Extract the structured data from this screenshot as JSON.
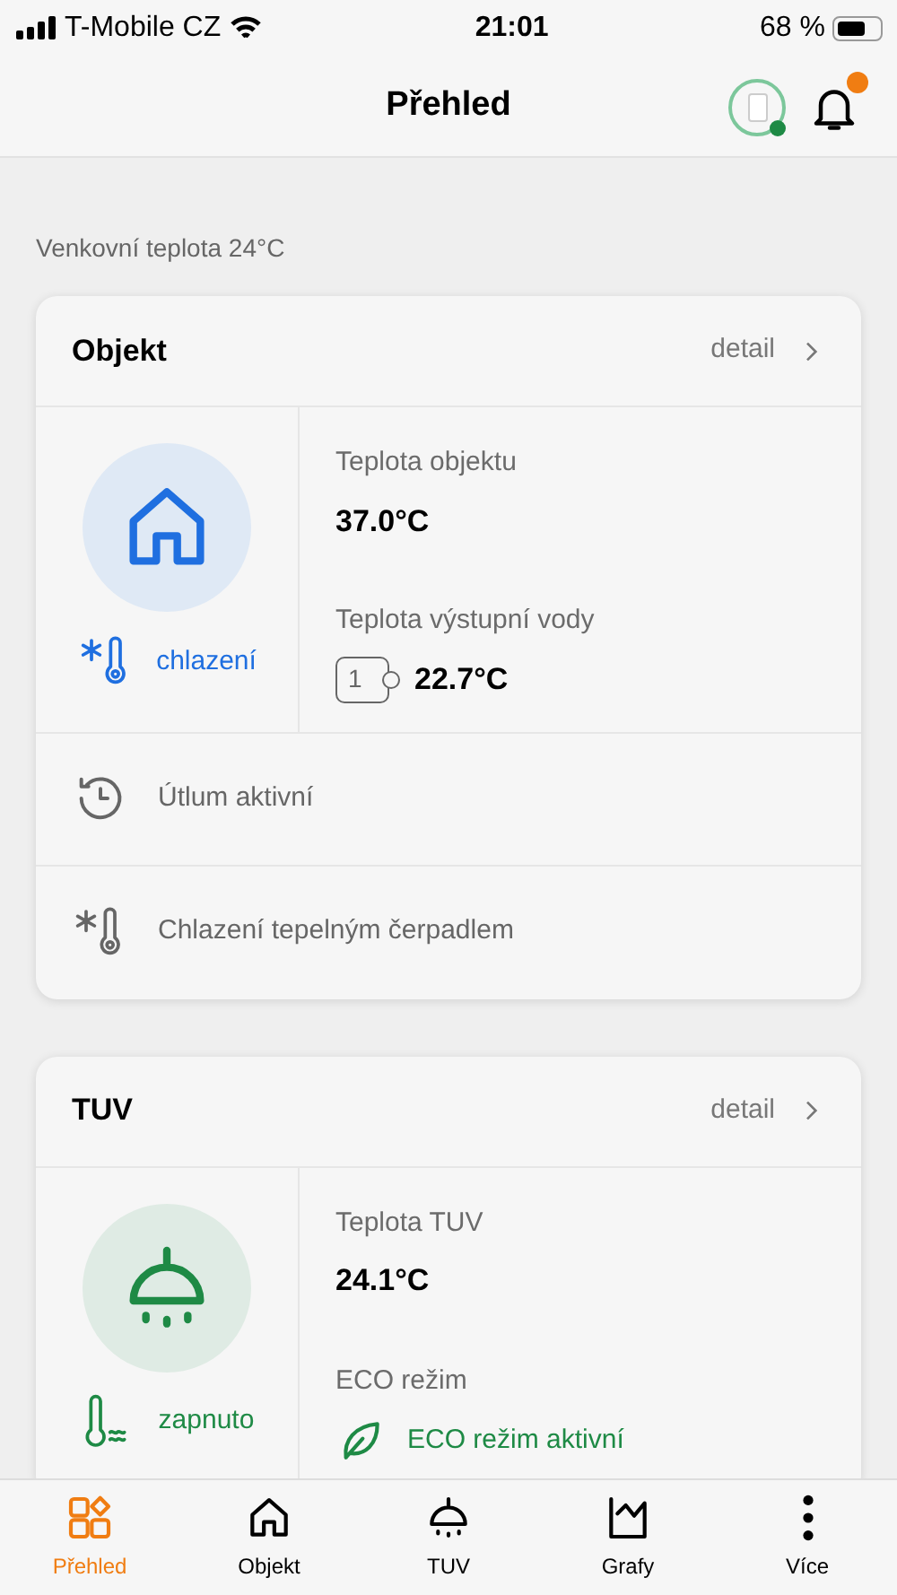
{
  "status_bar": {
    "carrier": "T-Mobile CZ",
    "time": "21:01",
    "battery": "68 %"
  },
  "header": {
    "title": "Přehled",
    "device_online": true,
    "notification": true
  },
  "outdoor": "Venkovní teplota 24°C",
  "cards": [
    {
      "kind": "objekt",
      "title": "Objekt",
      "detail": "detail",
      "status": "chlazení",
      "metrics": [
        {
          "kind": "plain",
          "label": "Teplota objektu",
          "value": "37.0°C"
        },
        {
          "kind": "zone",
          "label": "Teplota výstupní vody",
          "zone": "1",
          "value": "22.7°C"
        }
      ],
      "rows": [
        {
          "kind": "clock",
          "text": "Útlum aktivní"
        },
        {
          "kind": "cooling",
          "text": "Chlazení tepelným čerpadlem"
        }
      ]
    },
    {
      "kind": "tuv",
      "title": "TUV",
      "detail": "detail",
      "status": "zapnuto",
      "metrics": [
        {
          "kind": "plain",
          "label": "Teplota TUV",
          "value": "24.1°C"
        },
        {
          "kind": "eco",
          "label": "ECO režim",
          "value": "ECO režim aktivní"
        }
      ]
    }
  ],
  "tabs": [
    {
      "kind": "overview",
      "label": "Přehled",
      "selected": true
    },
    {
      "kind": "house",
      "label": "Objekt",
      "selected": false
    },
    {
      "kind": "shower",
      "label": "TUV",
      "selected": false
    },
    {
      "kind": "chart",
      "label": "Grafy",
      "selected": false
    },
    {
      "kind": "more",
      "label": "Více",
      "selected": false
    }
  ]
}
